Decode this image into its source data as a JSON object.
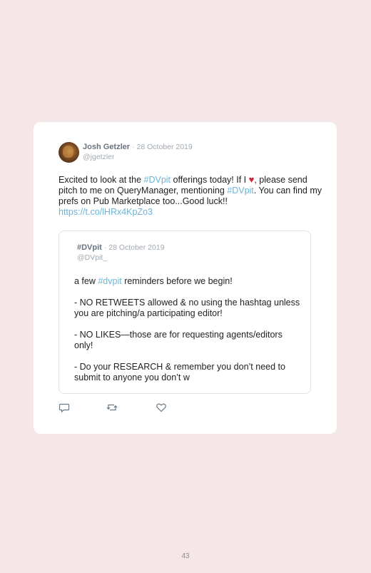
{
  "tweet": {
    "author_name": "Josh Getzler",
    "author_date": "· 28 October 2019",
    "author_handle": "@jgetzler",
    "text": {
      "p1": "Excited to look at the ",
      "tag1": "#DVpit",
      "p2": " offerings today! If I ",
      "heart": "♥",
      "p3": ", please send pitch to me on QueryManager, mentioning ",
      "tag2": "#DVpit",
      "p4": ". You can find my prefs on Pub Marketplace too...Good luck!! ",
      "link": "https://t.co/lHRx4KpZo3"
    }
  },
  "quote": {
    "name": "#DVpit",
    "date": "· 28 October 2019",
    "handle": "@DVpit_",
    "line1_pre": "a few ",
    "line1_tag": "#dvpit",
    "line1_post": " reminders before we begin!",
    "line2": "- NO RETWEETS allowed & no using the hashtag unless you are pitching/a participating editor!",
    "line3": "- NO LIKES—those are for requesting agents/editors only!",
    "line4": "- Do your RESEARCH & remember you don’t need to submit to anyone you don’t w"
  },
  "actions": {
    "reply_icon": "reply-icon",
    "retweet_icon": "retweet-icon",
    "like_icon": "like-icon"
  },
  "page_number": "43",
  "colors": {
    "background": "#f5e6e7",
    "card": "#ffffff",
    "hashtag": "#6cb4d8",
    "heart": "#d0233a",
    "meta": "#a0a8b0"
  }
}
